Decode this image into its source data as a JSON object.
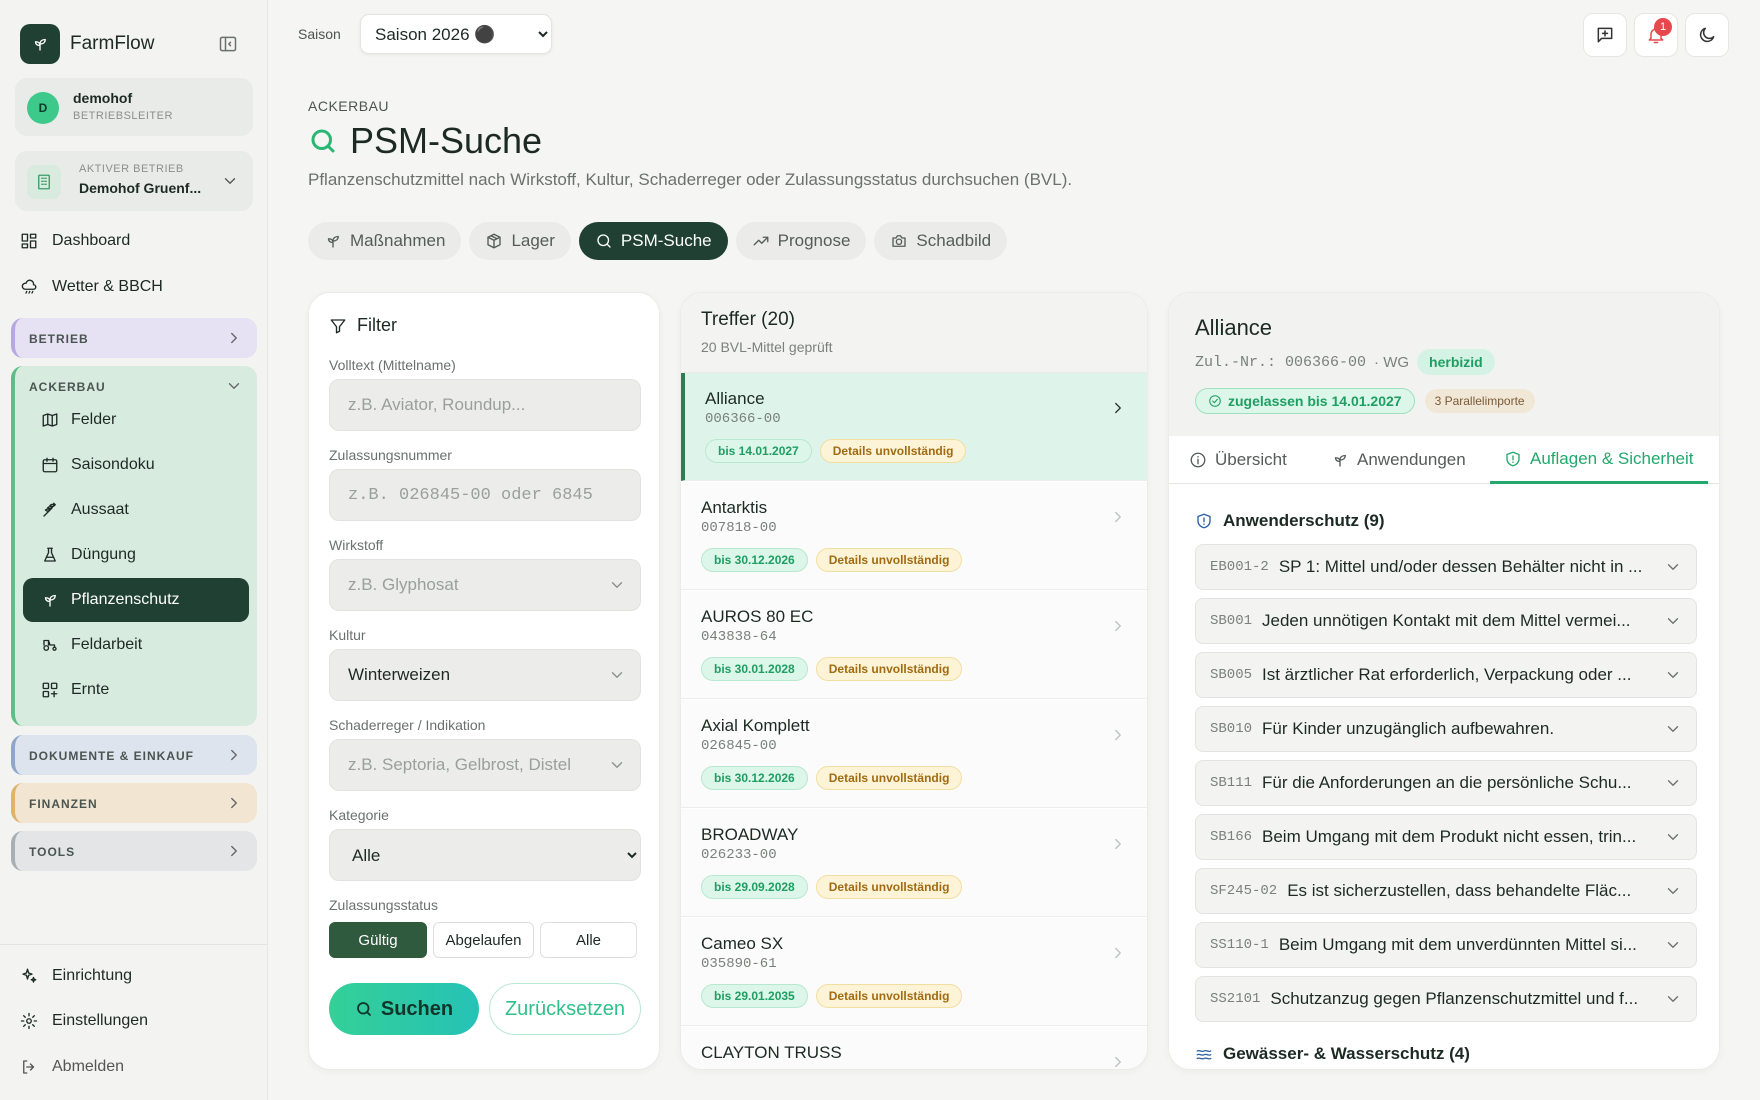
{
  "app": {
    "name": "FarmFlow"
  },
  "user": {
    "initial": "D",
    "name": "demohof",
    "role": "BETRIEBSLEITER"
  },
  "farm": {
    "label": "AKTIVER BETRIEB",
    "name": "Demohof Gruenf..."
  },
  "nav": {
    "dashboard": "Dashboard",
    "weather": "Wetter & BBCH",
    "group_betrieb": "BETRIEB",
    "group_ackerbau": "ACKERBAU",
    "ackerbau_items": [
      "Felder",
      "Saisondoku",
      "Aussaat",
      "Düngung",
      "Pflanzenschutz",
      "Feldarbeit",
      "Ernte"
    ],
    "group_dokumente": "DOKUMENTE & EINKAUF",
    "group_finanzen": "FINANZEN",
    "group_tools": "TOOLS",
    "setup": "Einrichtung",
    "settings": "Einstellungen",
    "logout": "Abmelden"
  },
  "topbar": {
    "season_label": "Saison",
    "season_options": [
      "Saison 2026 ⚫"
    ],
    "notification_count": "1"
  },
  "header": {
    "breadcrumb": "ACKERBAU",
    "title": "PSM-Suche",
    "description": "Pflanzenschutzmittel nach Wirkstoff, Kultur, Schaderreger oder Zulassungsstatus durchsuchen (BVL)."
  },
  "tabs": [
    "Maßnahmen",
    "Lager",
    "PSM-Suche",
    "Prognose",
    "Schadbild"
  ],
  "filter": {
    "title": "Filter",
    "fulltext_label": "Volltext (Mittelname)",
    "fulltext_placeholder": "z.B. Aviator, Roundup...",
    "number_label": "Zulassungsnummer",
    "number_placeholder": "z.B. 026845-00 oder 6845",
    "agent_label": "Wirkstoff",
    "agent_placeholder": "z.B. Glyphosat",
    "crop_label": "Kultur",
    "crop_value": "Winterweizen",
    "pest_label": "Schaderreger / Indikation",
    "pest_placeholder": "z.B. Septoria, Gelbrost, Distel",
    "category_label": "Kategorie",
    "category_options": [
      "Alle"
    ],
    "status_label": "Zulassungsstatus",
    "status_options": [
      "Gültig",
      "Abgelaufen",
      "Alle"
    ],
    "search_label": "Suchen",
    "reset_label": "Zurücksetzen"
  },
  "results": {
    "title": "Treffer (20)",
    "subtitle": "20 BVL-Mittel geprüft",
    "items": [
      {
        "name": "Alliance",
        "number": "006366-00",
        "valid": "bis 14.01.2027",
        "note": "Details unvollständig"
      },
      {
        "name": "Antarktis",
        "number": "007818-00",
        "valid": "bis 30.12.2026",
        "note": "Details unvollständig"
      },
      {
        "name": "AUROS 80 EC",
        "number": "043838-64",
        "valid": "bis 30.01.2028",
        "note": "Details unvollständig"
      },
      {
        "name": "Axial Komplett",
        "number": "026845-00",
        "valid": "bis 30.12.2026",
        "note": "Details unvollständig"
      },
      {
        "name": "BROADWAY",
        "number": "026233-00",
        "valid": "bis 29.09.2028",
        "note": "Details unvollständig"
      },
      {
        "name": "Cameo SX",
        "number": "035890-61",
        "valid": "bis 29.01.2035",
        "note": "Details unvollständig"
      },
      {
        "name": "CLAYTON TRUSS",
        "number": "",
        "valid": "",
        "note": ""
      }
    ]
  },
  "detail": {
    "title": "Alliance",
    "zul_prefix": "Zul.-Nr.: 006366-00",
    "formulation": "· WG",
    "type_tag": "herbizid",
    "status": "zugelassen bis 14.01.2027",
    "parallel": "3 Parallelimporte",
    "tabs": [
      "Übersicht",
      "Anwendungen",
      "Auflagen & Sicherheit"
    ],
    "section1": "Anwenderschutz (9)",
    "section2": "Gewässer- & Wasserschutz (4)",
    "requirements": [
      {
        "code": "EB001-2",
        "text": "SP 1: Mittel und/oder dessen Behälter nicht in ..."
      },
      {
        "code": "SB001",
        "text": "Jeden unnötigen Kontakt mit dem Mittel vermei..."
      },
      {
        "code": "SB005",
        "text": "Ist ärztlicher Rat erforderlich, Verpackung oder ..."
      },
      {
        "code": "SB010",
        "text": "Für Kinder unzugänglich aufbewahren."
      },
      {
        "code": "SB111",
        "text": "Für die Anforderungen an die persönliche Schu..."
      },
      {
        "code": "SB166",
        "text": "Beim Umgang mit dem Produkt nicht essen, trin..."
      },
      {
        "code": "SF245-02",
        "text": "Es ist sicherzustellen, dass behandelte Fläc..."
      },
      {
        "code": "SS110-1",
        "text": "Beim Umgang mit dem unverdünnten Mittel si..."
      },
      {
        "code": "SS2101",
        "text": "Schutzanzug gegen Pflanzenschutzmittel und f..."
      }
    ]
  },
  "colors": {
    "primary": "#1f4033",
    "accent": "#2bb673",
    "warning": "#a06b12",
    "danger": "#e5484d"
  }
}
